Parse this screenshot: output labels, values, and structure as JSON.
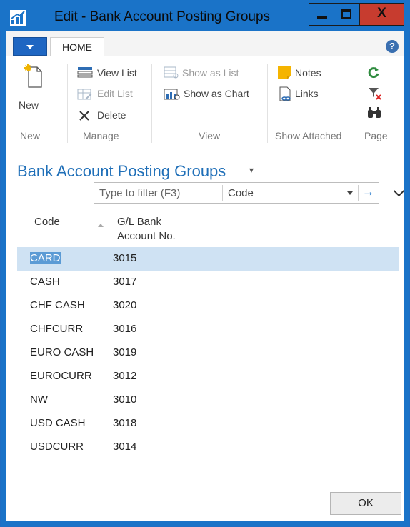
{
  "window": {
    "title": "Edit - Bank Account Posting Groups",
    "close_glyph": "X",
    "accent": "#1a73c8"
  },
  "tabs": {
    "home": "HOME",
    "help_glyph": "?"
  },
  "ribbon": {
    "new_label": "New",
    "view_list": "View List",
    "edit_list": "Edit List",
    "delete": "Delete",
    "show_as_list": "Show as List",
    "show_as_chart": "Show as Chart",
    "notes": "Notes",
    "links": "Links",
    "groups": {
      "new": "New",
      "manage": "Manage",
      "view": "View",
      "show_attached": "Show Attached",
      "page": "Page"
    },
    "icons": [
      "new-document-icon",
      "view-list-icon",
      "edit-list-icon",
      "delete-icon",
      "show-as-list-icon",
      "show-as-chart-icon",
      "notes-icon",
      "links-icon",
      "refresh-icon",
      "clear-filter-icon",
      "find-icon"
    ]
  },
  "page": {
    "title": "Bank Account Posting Groups",
    "title_caret": "▾"
  },
  "filter": {
    "placeholder": "Type to filter (F3)",
    "field": "Code",
    "go_glyph": "→"
  },
  "table": {
    "headers": {
      "code": "Code",
      "gl_line1": "G/L Bank",
      "gl_line2": "Account No."
    },
    "rows": [
      {
        "code": "CARD",
        "gl": "3015"
      },
      {
        "code": "CASH",
        "gl": "3017"
      },
      {
        "code": "CHF CASH",
        "gl": "3020"
      },
      {
        "code": "CHFCURR",
        "gl": "3016"
      },
      {
        "code": "EURO CASH",
        "gl": "3019"
      },
      {
        "code": "EUROCURR",
        "gl": "3012"
      },
      {
        "code": "NW",
        "gl": "3010"
      },
      {
        "code": "USD CASH",
        "gl": "3018"
      },
      {
        "code": "USDCURR",
        "gl": "3014"
      }
    ],
    "selected_row": 0
  },
  "footer": {
    "ok": "OK"
  }
}
